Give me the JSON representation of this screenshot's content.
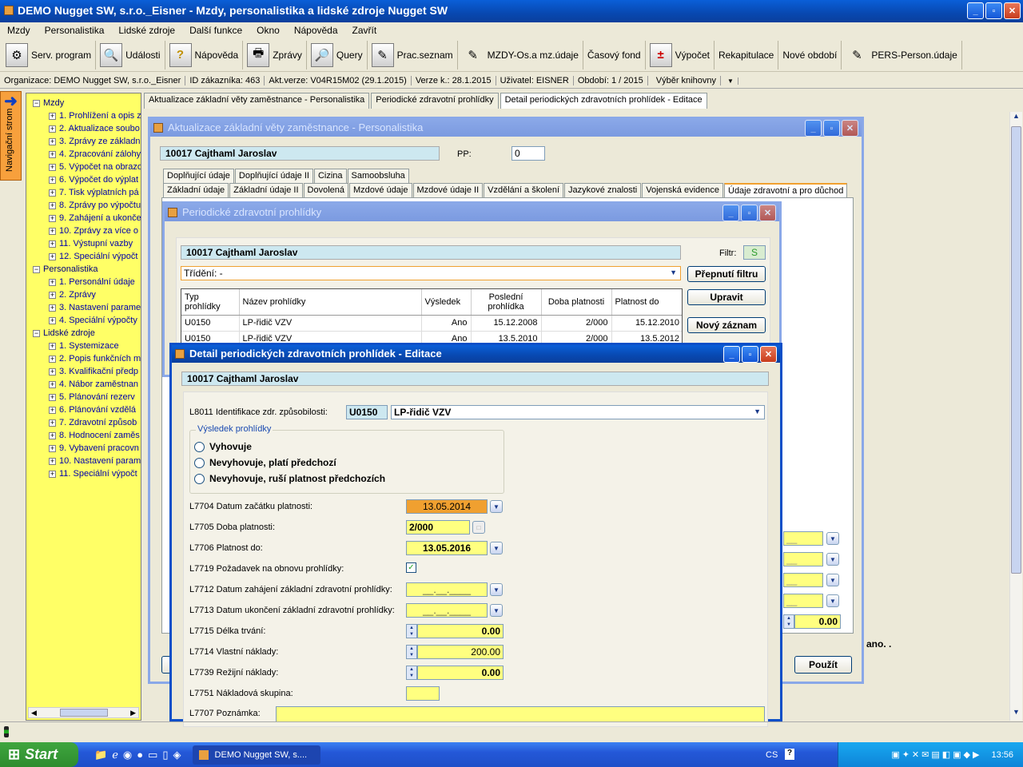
{
  "window": {
    "title": "DEMO Nugget SW, s.r.o._Eisner - Mzdy, personalistika a lidské zdroje Nugget SW",
    "min": "_",
    "max": "▫",
    "close": "✕"
  },
  "menu": [
    "Mzdy",
    "Personalistika",
    "Lidské zdroje",
    "Další funkce",
    "Okno",
    "Nápověda",
    "Zavřít"
  ],
  "toolbar": [
    {
      "icon": "gear-icon",
      "glyph": "⚙",
      "label": "Serv. program"
    },
    {
      "icon": "magnifier-icon",
      "glyph": "🔍",
      "label": "Události"
    },
    {
      "icon": "help-icon",
      "glyph": "?",
      "label": "Nápověda"
    },
    {
      "icon": "printer-icon",
      "glyph": "🖶",
      "label": "Zprávy"
    },
    {
      "icon": "query-icon",
      "glyph": "🔎",
      "label": "Query"
    },
    {
      "icon": "person-list-icon",
      "glyph": "✎",
      "label": "Prac.seznam"
    },
    {
      "icon": "notepad-icon",
      "glyph": "✎",
      "label": "MZDY-Os.a mz.údaje"
    },
    {
      "icon": "",
      "glyph": "",
      "label": "Časový fond"
    },
    {
      "icon": "calculator-icon",
      "glyph": "±",
      "label": "Výpočet"
    },
    {
      "icon": "",
      "glyph": "",
      "label": "Rekapitulace"
    },
    {
      "icon": "",
      "glyph": "",
      "label": "Nové období"
    },
    {
      "icon": "notepad-icon",
      "glyph": "✎",
      "label": "PERS-Person.údaje"
    }
  ],
  "status": [
    "Organizace: DEMO Nugget SW, s.r.o._Eisner",
    "ID zákazníka: 463",
    "Akt.verze: V04R15M02 (29.1.2015)",
    "Verze k.: 28.1.2015",
    "Uživatel: EISNER",
    "Období: 1 / 2015",
    "Výběr knihovny"
  ],
  "nav": {
    "label": "Navigační strom",
    "arrow": "➜"
  },
  "tree": [
    {
      "lvl": 0,
      "t": "Mzdy"
    },
    {
      "lvl": 1,
      "t": "1. Prohlížení a opis z"
    },
    {
      "lvl": 1,
      "t": "2. Aktualizace soubo"
    },
    {
      "lvl": 1,
      "t": "3. Zprávy ze základn"
    },
    {
      "lvl": 1,
      "t": "4. Zpracování zálohy"
    },
    {
      "lvl": 1,
      "t": "5. Výpočet na obrazo"
    },
    {
      "lvl": 1,
      "t": "6. Výpočet do výplat"
    },
    {
      "lvl": 1,
      "t": "7. Tisk výplatních pá"
    },
    {
      "lvl": 1,
      "t": "8. Zprávy po výpočtu"
    },
    {
      "lvl": 1,
      "t": "9. Zahájení a ukonče"
    },
    {
      "lvl": 1,
      "t": "10. Zprávy za více o"
    },
    {
      "lvl": 1,
      "t": "11. Výstupní vazby"
    },
    {
      "lvl": 1,
      "t": "12. Speciální výpočt"
    },
    {
      "lvl": 0,
      "t": "Personalistika"
    },
    {
      "lvl": 1,
      "t": "1. Personální údaje"
    },
    {
      "lvl": 1,
      "t": "2. Zprávy"
    },
    {
      "lvl": 1,
      "t": "3. Nastavení parame"
    },
    {
      "lvl": 1,
      "t": "4. Speciální výpočty"
    },
    {
      "lvl": 0,
      "t": "Lidské zdroje"
    },
    {
      "lvl": 1,
      "t": "1. Systemizace"
    },
    {
      "lvl": 1,
      "t": "2. Popis funkčních m"
    },
    {
      "lvl": 1,
      "t": "3. Kvalifikační předp"
    },
    {
      "lvl": 1,
      "t": "4. Nábor zaměstnan"
    },
    {
      "lvl": 1,
      "t": "5. Plánování rezerv"
    },
    {
      "lvl": 1,
      "t": "6. Plánování vzdělá"
    },
    {
      "lvl": 1,
      "t": "7. Zdravotní způsob"
    },
    {
      "lvl": 1,
      "t": "8. Hodnocení zaměs"
    },
    {
      "lvl": 1,
      "t": "9. Vybavení pracovn"
    },
    {
      "lvl": 1,
      "t": "10. Nastavení param"
    },
    {
      "lvl": 1,
      "t": "11. Speciální výpočt"
    }
  ],
  "doctabs": [
    "Aktualizace základní věty zaměstnance - Personalistika",
    "Periodické zdravotní prohlídky",
    "Detail periodických zdravotních prohlídek - Editace"
  ],
  "w1": {
    "title": "Aktualizace základní věty zaměstnance - Personalistika",
    "emp": "10017   Cajthaml Jaroslav",
    "pp_label": "PP:",
    "pp_value": "0",
    "tabs1": [
      "Doplňující údaje",
      "Doplňující údaje II",
      "Cizina",
      "Samoobsluha"
    ],
    "tabs2": [
      "Základní údaje",
      "Základní údaje II",
      "Dovolená",
      "Mzdové údaje",
      "Mzdové údaje II",
      "Vzdělání a školení",
      "Jazykové znalosti",
      "Vojenská evidence",
      "Údaje zdravotní a pro důchod"
    ],
    "amount": "0.00",
    "right_text": "ano. .",
    "pouzit": "Použít"
  },
  "w2": {
    "title": "Periodické zdravotní prohlídky",
    "emp": "10017   Cajthaml Jaroslav",
    "filtr_label": "Filtr:",
    "filtr_value": "S",
    "trideni": "Třídění: -",
    "btn_filter": "Přepnutí filtru",
    "btn_edit": "Upravit",
    "btn_new": "Nový záznam",
    "cols": [
      "Typ prohlídky",
      "Název prohlídky",
      "Výsledek",
      "Poslední prohlídka",
      "Doba platnosti",
      "Platnost do"
    ],
    "rows": [
      [
        "U0150",
        "LP-řidič VZV",
        "Ano",
        "15.12.2008",
        "2/000",
        "15.12.2010"
      ],
      [
        "U0150",
        "LP-řidič VZV",
        "Ano",
        "13.5.2010",
        "2/000",
        "13.5.2012"
      ]
    ]
  },
  "w3": {
    "title": "Detail periodických zdravotních prohlídek - Editace",
    "emp": "10017   Cajthaml Jaroslav",
    "ident_label": "L8011 Identifikace zdr. způsobilosti:",
    "ident_code": "U0150",
    "ident_name": "LP-řidič VZV",
    "result_group": "Výsledek prohlídky",
    "radios": [
      "Vyhovuje",
      "Nevyhovuje, platí předchozí",
      "Nevyhovuje, ruší platnost předchozích"
    ],
    "l7704": "L7704 Datum začátku platnosti:",
    "v7704": "13.05.2014",
    "l7705": "L7705 Doba platnosti:",
    "v7705": "2/000",
    "l7706": "L7706 Platnost do:",
    "v7706": "13.05.2016",
    "l7719": "L7719 Požadavek na obnovu prohlídky:",
    "v7719": "✓",
    "l7712": "L7712 Datum zahájení základní zdravotní prohlídky:",
    "v7712": "__.__.____",
    "l7713": "L7713 Datum ukončení základní zdravotní prohlídky:",
    "v7713": "__.__.____",
    "l7715": "L7715 Délka trvání:",
    "v7715": "0.00",
    "l7714": "L7714 Vlastní náklady:",
    "v7714": "200.00",
    "l7739": "L7739 Režijní náklady:",
    "v7739": "0.00",
    "l7751": "L7751 Nákladová skupina:",
    "v7751": "",
    "l7707": "L7707 Poznámka:",
    "v7707": ""
  },
  "taskbar": {
    "start": "Start",
    "task": "DEMO Nugget SW, s....",
    "lang": "CS",
    "time": "13:56"
  },
  "colors": {
    "accent": "#0a5fd8",
    "field": "#ffff80",
    "highlight": "#f0a030",
    "tree": "#ffff66"
  }
}
